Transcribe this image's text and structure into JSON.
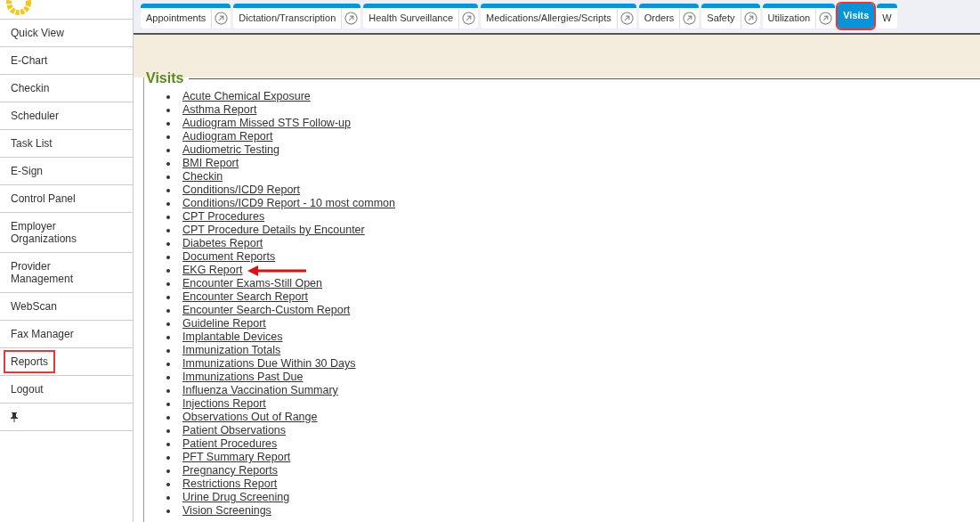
{
  "sidebar": {
    "items": [
      {
        "label": "Quick View",
        "selected": false
      },
      {
        "label": "E-Chart",
        "selected": false
      },
      {
        "label": "Checkin",
        "selected": false
      },
      {
        "label": "Scheduler",
        "selected": false
      },
      {
        "label": "Task List",
        "selected": false
      },
      {
        "label": "E-Sign",
        "selected": false
      },
      {
        "label": "Control Panel",
        "selected": false
      },
      {
        "label": "Employer Organizations",
        "selected": false
      },
      {
        "label": "Provider Management",
        "selected": false
      },
      {
        "label": "WebScan",
        "selected": false
      },
      {
        "label": "Fax Manager",
        "selected": false
      },
      {
        "label": "Reports",
        "selected": true
      },
      {
        "label": "Logout",
        "selected": false
      }
    ]
  },
  "tabs": [
    {
      "label": "Appointments",
      "selected": false
    },
    {
      "label": "Dictation/Transcription",
      "selected": false
    },
    {
      "label": "Health Surveillance",
      "selected": false
    },
    {
      "label": "Medications/Allergies/Scripts",
      "selected": false
    },
    {
      "label": "Orders",
      "selected": false
    },
    {
      "label": "Safety",
      "selected": false
    },
    {
      "label": "Utilization",
      "selected": false
    },
    {
      "label": "Visits",
      "selected": true
    },
    {
      "label": "W",
      "selected": false
    }
  ],
  "section": {
    "title": "Visits",
    "reports": [
      {
        "label": "Acute Chemical Exposure",
        "pointed": false
      },
      {
        "label": "Asthma Report",
        "pointed": false
      },
      {
        "label": "Audiogram Missed STS Follow-up",
        "pointed": false
      },
      {
        "label": "Audiogram Report",
        "pointed": false
      },
      {
        "label": "Audiometric Testing",
        "pointed": false
      },
      {
        "label": "BMI Report",
        "pointed": false
      },
      {
        "label": "Checkin",
        "pointed": false
      },
      {
        "label": "Conditions/ICD9 Report",
        "pointed": false
      },
      {
        "label": "Conditions/ICD9 Report - 10 most common",
        "pointed": false
      },
      {
        "label": "CPT Procedures",
        "pointed": false
      },
      {
        "label": "CPT Procedure Details by Encounter",
        "pointed": false
      },
      {
        "label": "Diabetes Report",
        "pointed": false
      },
      {
        "label": "Document Reports",
        "pointed": false
      },
      {
        "label": "EKG Report",
        "pointed": true
      },
      {
        "label": "Encounter Exams-Still Open",
        "pointed": false
      },
      {
        "label": "Encounter Search Report",
        "pointed": false
      },
      {
        "label": "Encounter Search-Custom Report",
        "pointed": false
      },
      {
        "label": "Guideline Report",
        "pointed": false
      },
      {
        "label": "Implantable Devices",
        "pointed": false
      },
      {
        "label": "Immunization Totals",
        "pointed": false
      },
      {
        "label": "Immunizations Due Within 30 Days",
        "pointed": false
      },
      {
        "label": "Immunizations Past Due",
        "pointed": false
      },
      {
        "label": "Influenza Vaccination Summary",
        "pointed": false
      },
      {
        "label": "Injections Report",
        "pointed": false
      },
      {
        "label": "Observations Out of Range",
        "pointed": false
      },
      {
        "label": "Patient Observations",
        "pointed": false
      },
      {
        "label": "Patient Procedures",
        "pointed": false
      },
      {
        "label": "PFT Summary Report",
        "pointed": false
      },
      {
        "label": "Pregnancy Reports",
        "pointed": false
      },
      {
        "label": "Restrictions Report",
        "pointed": false
      },
      {
        "label": "Urine Drug Screening",
        "pointed": false
      },
      {
        "label": "Vision Screenings",
        "pointed": false
      }
    ]
  }
}
